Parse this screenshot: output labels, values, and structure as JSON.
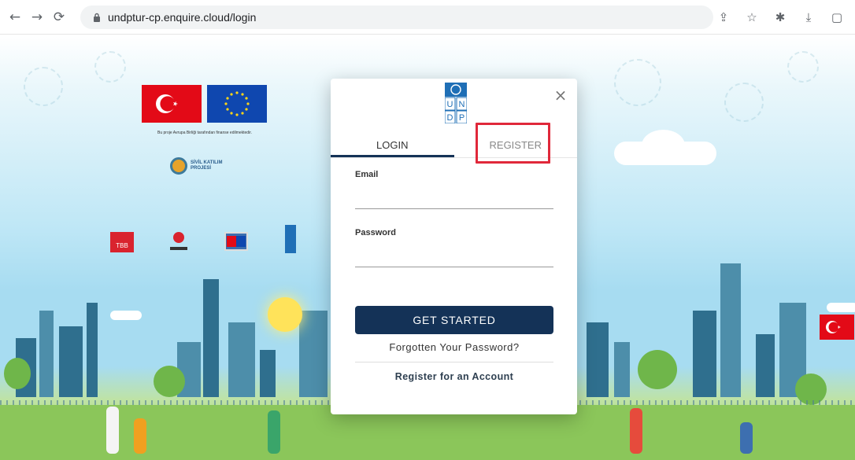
{
  "browser": {
    "url": "undptur-cp.enquire.cloud/login",
    "icons": [
      "back-arrow-icon",
      "forward-arrow-icon",
      "reload-icon",
      "lock-icon",
      "share-icon",
      "star-icon",
      "extensions-icon",
      "download-icon",
      "window-icon"
    ]
  },
  "logos": {
    "funded_text": "Bu proje Avrupa Birliği tarafından finanse edilmektedir.",
    "sivil_line1": "SİVİL KATILIM",
    "sivil_line2": "PROJESİ",
    "tbb_text": "TBB"
  },
  "modal": {
    "undp_letters": [
      "U",
      "N",
      "D",
      "P"
    ],
    "tabs": [
      {
        "label": "LOGIN",
        "active": true
      },
      {
        "label": "REGISTER",
        "active": false
      }
    ],
    "email_label": "Email",
    "password_label": "Password",
    "submit_label": "GET STARTED",
    "forgot_label": "Forgotten Your Password?",
    "register_link": "Register for an Account"
  },
  "colors": {
    "primary": "#143257",
    "highlight": "#e0283a"
  }
}
